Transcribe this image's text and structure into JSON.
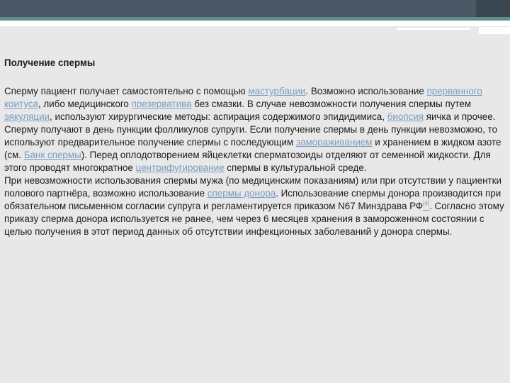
{
  "heading": "Получение спермы",
  "paragraphs": [
    [
      {
        "t": "Сперму пациент получает самостоятельно с помощью "
      },
      {
        "t": "мастурбации",
        "link": true
      },
      {
        "t": ". Возможно использование "
      },
      {
        "t": "прерванного коитуса",
        "link": true
      },
      {
        "t": ", либо медицинского "
      },
      {
        "t": "презерватива",
        "link": true
      },
      {
        "t": " без смазки. В случае невозможности получения спермы путем "
      },
      {
        "t": "эякуляции",
        "link": true
      },
      {
        "t": ", используют хирургические методы: аспирация содержимого эпидидимиса, "
      },
      {
        "t": "биопсия",
        "link": true
      },
      {
        "t": " яичка и прочее. Сперму получают в день пункции фолликулов супруги. Если получение спермы в день пункции невозможно, то используют предварительное получение спермы с последующим "
      },
      {
        "t": "замораживанием",
        "link": true
      },
      {
        "t": " и хранением в жидком азоте (см. "
      },
      {
        "t": "Банк спермы",
        "link": true
      },
      {
        "t": "). Перед оплодотворением яйцеклетки сперматозоиды отделяют от семенной жидкости. Для этого проводят многократное "
      },
      {
        "t": "центрифугирование",
        "link": true
      },
      {
        "t": " спермы в культуральной среде."
      }
    ],
    [
      {
        "t": "При невозможности использования спермы мужа (по медицинским показаниям) или при отсутствии у пациентки полового партнёра, возможно использование "
      },
      {
        "t": "спермы донора",
        "link": true
      },
      {
        "t": ". Использование спермы донора производится при обязательном письменном согласии супруга и регламентируется приказом N67 Минздрава РФ"
      },
      {
        "t": "[4]",
        "link": true,
        "sup": true
      },
      {
        "t": ". Согласно этому приказу сперма донора используется не ранее, чем через 6 месяцев хранения в замороженном состоянии с целью получения в этот период данных об отсутствии инфекционных заболеваний у донора спермы."
      }
    ]
  ]
}
